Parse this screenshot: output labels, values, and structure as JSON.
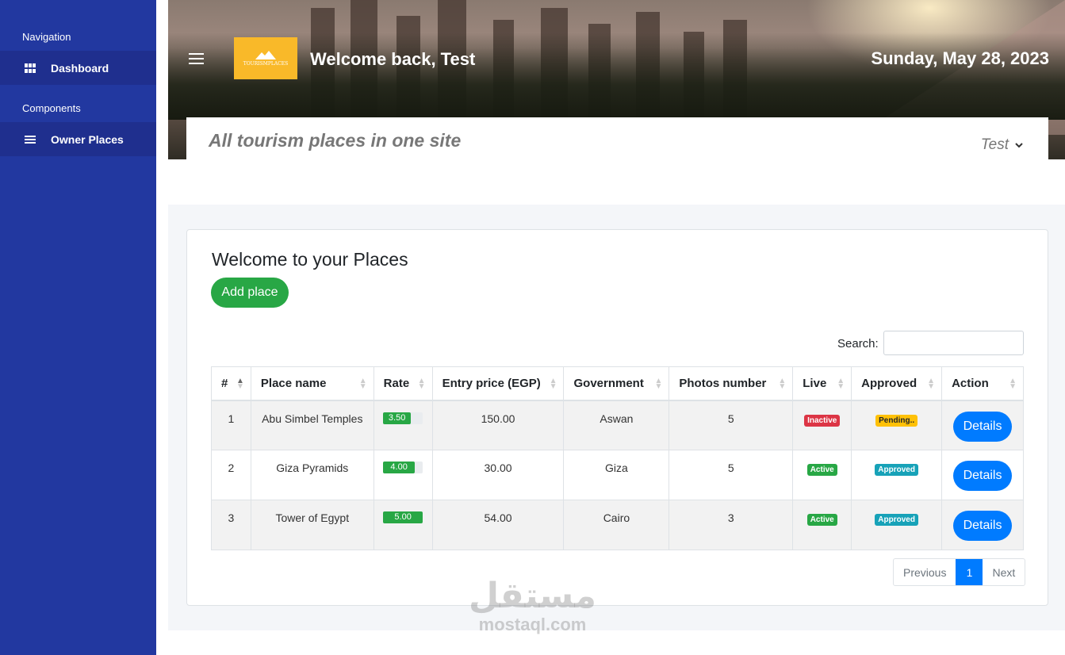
{
  "sidebar": {
    "section_navigation": "Navigation",
    "dashboard_label": "Dashboard",
    "section_components": "Components",
    "owner_places_label": "Owner Places"
  },
  "header": {
    "logo_text": "TOURISMPLACES",
    "welcome": "Welcome back, Test",
    "date": "Sunday, May 28, 2023",
    "tagline": "All tourism places in one site",
    "user": "Test"
  },
  "main": {
    "title": "Welcome to your Places",
    "add_button": "Add place",
    "search_label": "Search:",
    "search_value": "",
    "columns": [
      "#",
      "Place name",
      "Rate",
      "Entry price (EGP)",
      "Government",
      "Photos number",
      "Live",
      "Approved",
      "Action"
    ],
    "rows": [
      {
        "num": "1",
        "name": "Abu Simbel Temples",
        "rate": "3.50",
        "rate_fraction": 0.7,
        "price": "150.00",
        "government": "Aswan",
        "photos": "5",
        "live": "Inactive",
        "approved": "Pending..",
        "action": "Details"
      },
      {
        "num": "2",
        "name": "Giza Pyramids",
        "rate": "4.00",
        "rate_fraction": 0.8,
        "price": "30.00",
        "government": "Giza",
        "photos": "5",
        "live": "Active",
        "approved": "Approved",
        "action": "Details"
      },
      {
        "num": "3",
        "name": "Tower of Egypt",
        "rate": "5.00",
        "rate_fraction": 1.0,
        "price": "54.00",
        "government": "Cairo",
        "photos": "3",
        "live": "Active",
        "approved": "Approved",
        "action": "Details"
      }
    ],
    "pagination": {
      "previous": "Previous",
      "current": "1",
      "next": "Next"
    }
  },
  "watermark": {
    "arabic": "مستقل",
    "latin": "mostaql.com"
  },
  "colors": {
    "sidebar": "#2238a0",
    "success": "#28a745",
    "primary": "#007bff",
    "danger": "#dc3545",
    "warning": "#ffc107",
    "info": "#17a2b8",
    "logo": "#f9b929"
  }
}
